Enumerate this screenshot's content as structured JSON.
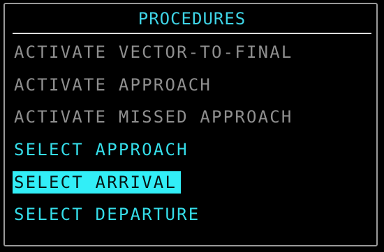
{
  "title": "PROCEDURES",
  "menu": {
    "items": [
      {
        "label": "ACTIVATE VECTOR-TO-FINAL",
        "state": "disabled"
      },
      {
        "label": "ACTIVATE APPROACH",
        "state": "disabled"
      },
      {
        "label": "ACTIVATE MISSED APPROACH",
        "state": "disabled"
      },
      {
        "label": "SELECT APPROACH",
        "state": "enabled"
      },
      {
        "label": "SELECT ARRIVAL",
        "state": "selected"
      },
      {
        "label": "SELECT DEPARTURE",
        "state": "enabled"
      }
    ]
  },
  "colors": {
    "background": "#000000",
    "title": "#3fd4e6",
    "disabled_text": "#8f8f8f",
    "enabled_text": "#35dde9",
    "selection_highlight": "#32eef7",
    "frame": "#9a9a9a"
  }
}
